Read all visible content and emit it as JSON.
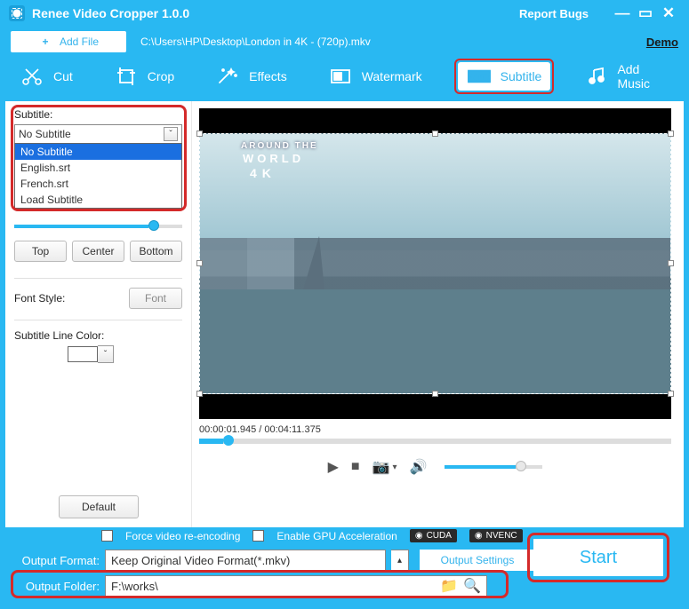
{
  "titlebar": {
    "title": "Renee Video Cropper 1.0.0",
    "report": "Report Bugs"
  },
  "toprow": {
    "addfile": "Add File",
    "filepath": "C:\\Users\\HP\\Desktop\\London in 4K - (720p).mkv",
    "demo": "Demo"
  },
  "tabs": {
    "cut": "Cut",
    "crop": "Crop",
    "effects": "Effects",
    "watermark": "Watermark",
    "subtitle": "Subtitle",
    "addmusic": "Add Music"
  },
  "side": {
    "subtitle_label": "Subtitle:",
    "combo_value": "No Subtitle",
    "options": {
      "o0": "No Subtitle",
      "o1": "English.srt",
      "o2": "French.srt",
      "o3": "Load Subtitle"
    },
    "top": "Top",
    "center": "Center",
    "bottom": "Bottom",
    "fontstyle": "Font Style:",
    "font": "Font",
    "linecolor": "Subtitle Line Color:",
    "default": "Default"
  },
  "preview": {
    "wm1": "AROUND THE",
    "wm2": "WORLD",
    "wm3": "4K",
    "time": "00:00:01.945 / 00:04:11.375"
  },
  "bottom": {
    "force": "Force video re-encoding",
    "gpu": "Enable GPU Acceleration",
    "cuda": "CUDA",
    "nvenc": "NVENC",
    "outfmt_label": "Output Format:",
    "outfmt_value": "Keep Original Video Format(*.mkv)",
    "outset": "Output Settings",
    "outfolder_label": "Output Folder:",
    "outfolder_value": "F:\\works\\",
    "start": "Start"
  }
}
